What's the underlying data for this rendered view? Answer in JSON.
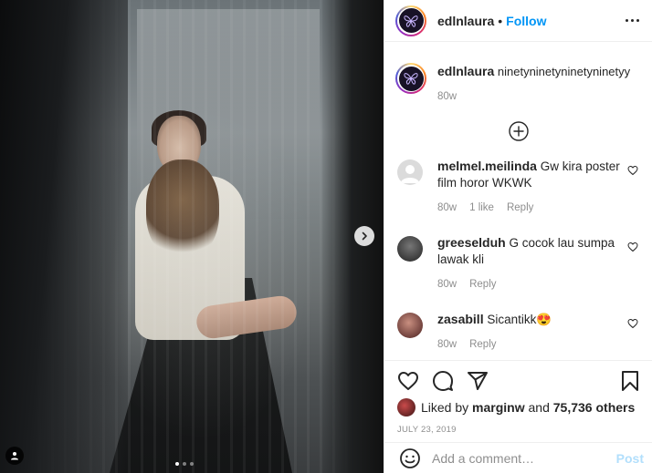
{
  "post": {
    "image_alt": "Photo by edlnlaura",
    "carousel": {
      "total": 3,
      "active_index": 0
    }
  },
  "header": {
    "username": "edlnlaura",
    "separator": "•",
    "follow_label": "Follow"
  },
  "caption": {
    "username": "edlnlaura",
    "text": "ninetyninetyninetyninetyy",
    "time": "80w"
  },
  "comments": [
    {
      "username": "melmel.meilinda",
      "text": "Gw kira poster film horor WKWK",
      "time": "80w",
      "likes": "1 like",
      "reply_label": "Reply",
      "avatar_color": "#dbdbdb"
    },
    {
      "username": "greeselduh",
      "text": "G cocok lau sumpa lawak kli",
      "time": "80w",
      "likes": "",
      "reply_label": "Reply",
      "avatar_color": "#3b3b3b"
    },
    {
      "username": "zasabill",
      "text": "Sicantikk😍",
      "time": "80w",
      "likes": "",
      "reply_label": "Reply",
      "avatar_color": "#7a3c3c"
    }
  ],
  "actions": {
    "liked_by_prefix": "Liked by",
    "liked_by_user": "marginw",
    "and_label": "and",
    "others_count": "75,736 others",
    "date": "JULY 23, 2019"
  },
  "add_comment": {
    "placeholder": "Add a comment…",
    "post_label": "Post"
  },
  "colors": {
    "follow_blue": "#0095f6",
    "post_disabled": "#b2dffc",
    "meta_gray": "#8e8e8e"
  }
}
